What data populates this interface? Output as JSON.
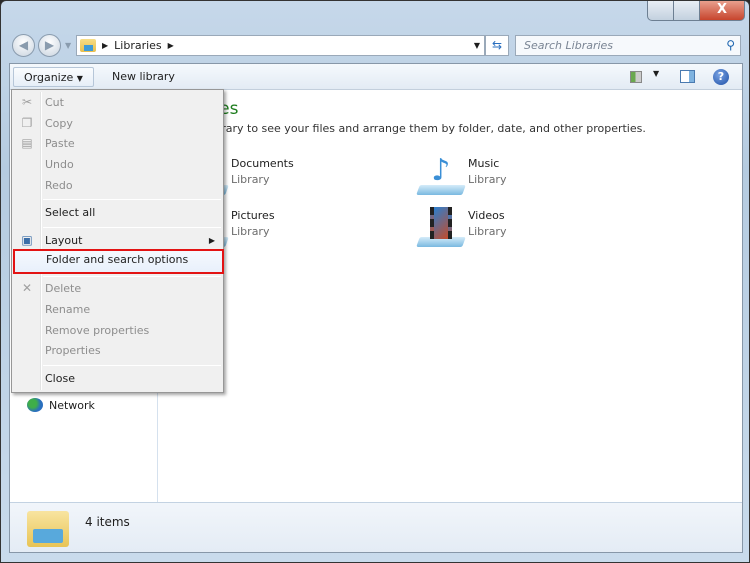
{
  "window": {
    "close_glyph": "X"
  },
  "address": {
    "crumbs": [
      "Libraries"
    ],
    "search_placeholder": "Search Libraries"
  },
  "toolbar": {
    "organize": "Organize",
    "new_library": "New library"
  },
  "nav": {
    "items": [
      {
        "label": "Network",
        "icon": "network-icon"
      }
    ]
  },
  "main": {
    "title": "Libraries",
    "description": "Open a library to see your files and arrange them by folder, date, and other properties.",
    "libraries": [
      {
        "name": "Documents",
        "type": "Library",
        "icon": "documents-library-icon"
      },
      {
        "name": "Music",
        "type": "Library",
        "icon": "music-library-icon"
      },
      {
        "name": "Pictures",
        "type": "Library",
        "icon": "pictures-library-icon"
      },
      {
        "name": "Videos",
        "type": "Library",
        "icon": "videos-library-icon"
      }
    ]
  },
  "status": {
    "count": "4 items"
  },
  "menu": {
    "items": [
      {
        "label": "Cut",
        "enabled": false
      },
      {
        "label": "Copy",
        "enabled": false
      },
      {
        "label": "Paste",
        "enabled": false
      },
      {
        "label": "Undo",
        "enabled": false
      },
      {
        "label": "Redo",
        "enabled": false
      },
      {
        "label": "Select all",
        "enabled": true
      },
      {
        "label": "Layout",
        "enabled": true,
        "submenu": true
      },
      {
        "label": "Folder and search options",
        "enabled": true,
        "highlighted": true
      },
      {
        "label": "Delete",
        "enabled": false
      },
      {
        "label": "Rename",
        "enabled": false
      },
      {
        "label": "Remove properties",
        "enabled": false
      },
      {
        "label": "Properties",
        "enabled": false
      },
      {
        "label": "Close",
        "enabled": true
      }
    ]
  },
  "colors": {
    "title_green": "#1e7d1e",
    "highlight_border": "#e31313"
  }
}
